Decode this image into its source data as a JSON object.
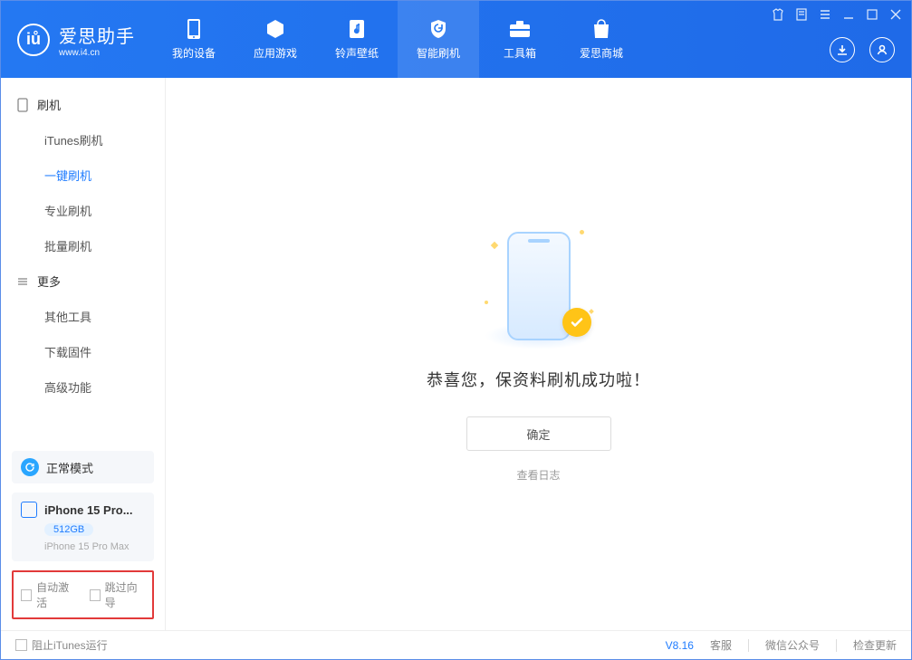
{
  "brand": {
    "title": "爱思助手",
    "url": "www.i4.cn"
  },
  "nav": {
    "items": [
      {
        "label": "我的设备"
      },
      {
        "label": "应用游戏"
      },
      {
        "label": "铃声壁纸"
      },
      {
        "label": "智能刷机"
      },
      {
        "label": "工具箱"
      },
      {
        "label": "爱思商城"
      }
    ]
  },
  "sidebar": {
    "section_flash": "刷机",
    "flash_items": [
      {
        "label": "iTunes刷机"
      },
      {
        "label": "一键刷机"
      },
      {
        "label": "专业刷机"
      },
      {
        "label": "批量刷机"
      }
    ],
    "section_more": "更多",
    "more_items": [
      {
        "label": "其他工具"
      },
      {
        "label": "下载固件"
      },
      {
        "label": "高级功能"
      }
    ],
    "mode_label": "正常模式",
    "device": {
      "name": "iPhone 15 Pro...",
      "storage": "512GB",
      "full_name": "iPhone 15 Pro Max"
    },
    "auto_activate": "自动激活",
    "skip_guide": "跳过向导"
  },
  "main": {
    "success_message": "恭喜您，保资料刷机成功啦！",
    "ok_button": "确定",
    "view_log": "查看日志"
  },
  "footer": {
    "block_itunes": "阻止iTunes运行",
    "version": "V8.16",
    "support": "客服",
    "wechat": "微信公众号",
    "check_update": "检查更新"
  }
}
